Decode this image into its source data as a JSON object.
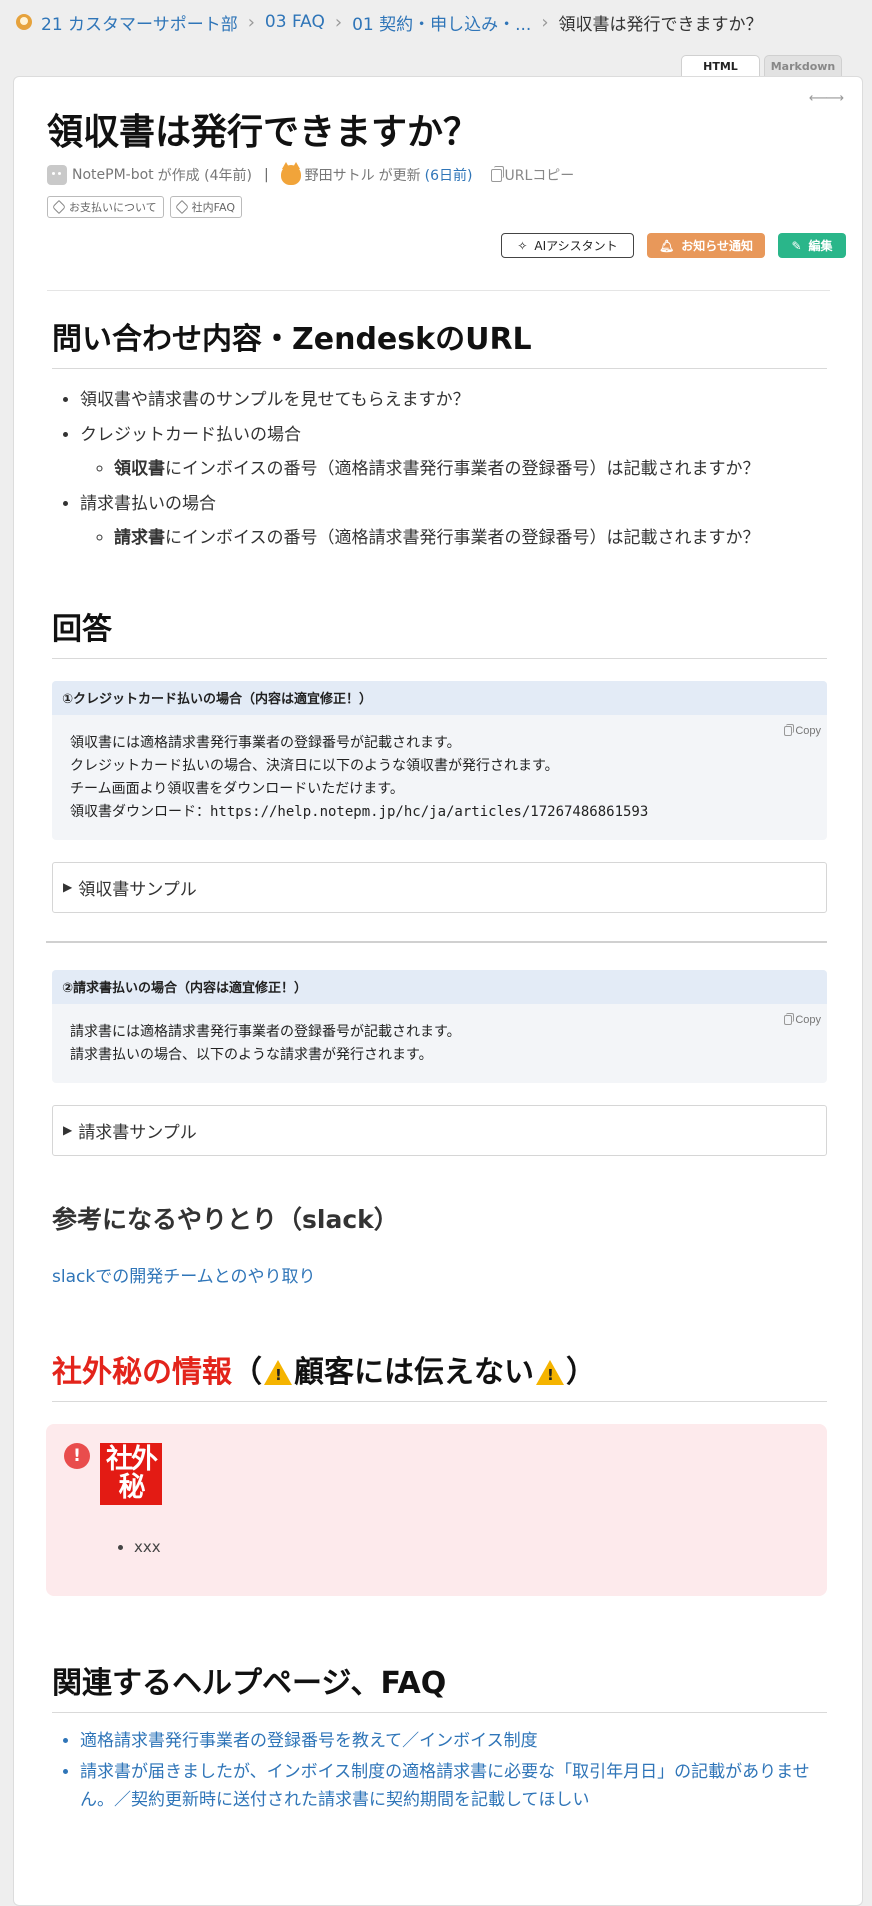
{
  "breadcrumb": {
    "items": [
      "21 カスタマーサポート部",
      "03 FAQ",
      "01 契約・申し込み・..."
    ],
    "current": "領収書は発行できますか？"
  },
  "view_tabs": [
    "HTML",
    "Markdown"
  ],
  "page": {
    "title": "領収書は発行できますか？",
    "meta": {
      "creator": "NotePM-bot",
      "created_suffix": "が作成 (4年前)",
      "separator": "|",
      "updater": "野田サトル",
      "updated_suffix": "が更新",
      "updated_ago": "(6日前)",
      "copy_url": "URLコピー"
    },
    "tags": [
      "お支払いについて",
      "社内FAQ"
    ],
    "actions": {
      "ai": "AIアシスタント",
      "notify": "お知らせ通知",
      "edit": "編集"
    }
  },
  "content": {
    "inquiry": {
      "heading": "問い合わせ内容・ZendeskのURL",
      "items": [
        {
          "text": "領収書や請求書のサンプルを見せてもらえますか？",
          "sub": []
        },
        {
          "text": "クレジットカード払いの場合",
          "sub": [
            {
              "bold": "領収書",
              "rest": "にインボイスの番号（適格請求書発行事業者の登録番号）は記載されますか？"
            }
          ]
        },
        {
          "text": "請求書払いの場合",
          "sub": [
            {
              "bold": "請求書",
              "rest": "にインボイスの番号（適格請求書発行事業者の登録番号）は記載されますか？"
            }
          ]
        }
      ]
    },
    "answer": {
      "heading": "回答",
      "copy_label": "Copy",
      "block1": {
        "title": "①クレジットカード払いの場合（内容は適宜修正！）",
        "lines": [
          "領収書には適格請求書発行事業者の登録番号が記載されます。",
          "クレジットカード払いの場合、決済日に以下のような領収書が発行されます。",
          "チーム画面より領収書をダウンロードいただけます。",
          "領収書ダウンロード：https://help.notepm.jp/hc/ja/articles/17267486861593"
        ],
        "details": "領収書サンプル"
      },
      "block2": {
        "title": "②請求書払いの場合（内容は適宜修正！）",
        "lines": [
          "請求書には適格請求書発行事業者の登録番号が記載されます。",
          "請求書払いの場合、以下のような請求書が発行されます。"
        ],
        "details": "請求書サンプル"
      }
    },
    "reference": {
      "heading": "参考になるやりとり（slack）",
      "link": "slackでの開発チームとのやり取り"
    },
    "confidential": {
      "heading_red": "社外秘の情報",
      "heading_open": "（",
      "heading_mid": "顧客には伝えない",
      "heading_close": "）",
      "stamp": [
        "社外",
        "秘"
      ],
      "item": "xxx"
    },
    "related": {
      "heading": "関連するヘルプページ、FAQ",
      "links": [
        "適格請求書発行事業者の登録番号を教えて／インボイス制度",
        "請求書が届きましたが、インボイス制度の適格請求書に必要な「取引年月日」の記載がありません。／契約更新時に送付された請求書に契約期間を記載してほしい"
      ]
    }
  },
  "colors": {
    "accent_link": "#2f75b8",
    "notify": "#e8985a",
    "edit": "#2ab68a",
    "danger": "#e3241b"
  }
}
